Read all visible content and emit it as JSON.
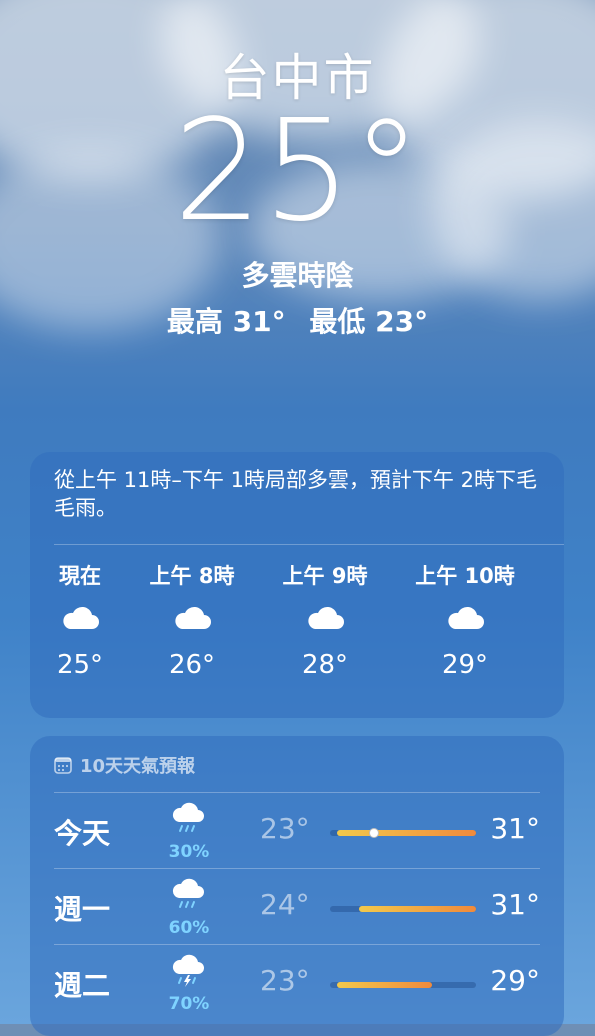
{
  "location": {
    "city": "台中市",
    "current_temp": "25°",
    "condition": "多雲時陰",
    "high": "最高 31°",
    "low": "最低 23°"
  },
  "hourly": {
    "summary": "從上午 11時–下午 1時局部多雲，預計下午 2時下毛毛雨。",
    "items": [
      {
        "label": "現在",
        "icon": "cloud-icon",
        "temp": "25°"
      },
      {
        "label": "上午 8時",
        "icon": "cloud-icon",
        "temp": "26°"
      },
      {
        "label": "上午 9時",
        "icon": "cloud-icon",
        "temp": "28°"
      },
      {
        "label": "上午 10時",
        "icon": "cloud-icon",
        "temp": "29°"
      }
    ]
  },
  "daily": {
    "title": "10天天氣預報",
    "icon": "calendar-icon",
    "rows": [
      {
        "day": "今天",
        "icon": "cloud-rain-icon",
        "precip": "30%",
        "low": "23°",
        "high": "31°",
        "bar_start": 0.05,
        "bar_end": 1.0,
        "current_pos": 0.3
      },
      {
        "day": "週一",
        "icon": "cloud-rain-icon",
        "precip": "60%",
        "low": "24°",
        "high": "31°",
        "bar_start": 0.2,
        "bar_end": 1.0
      },
      {
        "day": "週二",
        "icon": "cloud-bolt-rain-icon",
        "precip": "70%",
        "low": "23°",
        "high": "29°",
        "bar_start": 0.05,
        "bar_end": 0.7
      }
    ]
  },
  "colors": {
    "precip": "#7fd3ff",
    "bar_warm": "#f08a3c",
    "bar_mild": "#f2c94c"
  }
}
